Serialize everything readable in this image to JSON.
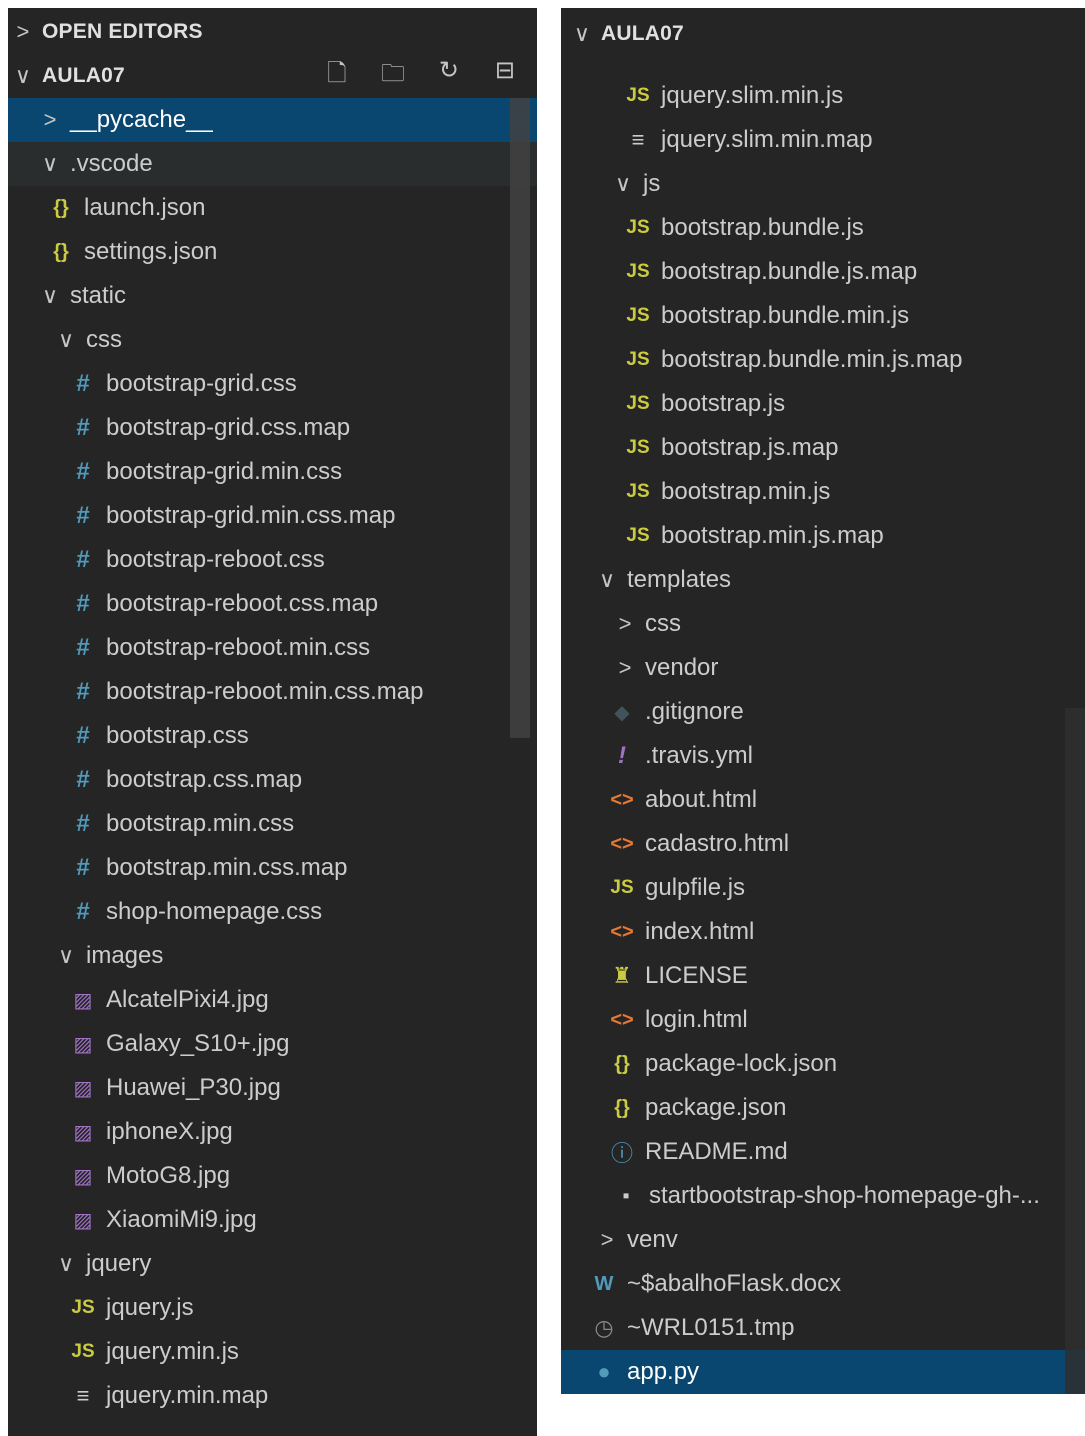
{
  "left_panel": {
    "open_editors_label": "OPEN EDITORS",
    "workspace_label": "AULA07",
    "header_actions": [
      "new-file-icon",
      "new-folder-icon",
      "refresh-icon",
      "collapse-all-icon"
    ],
    "rows": [
      {
        "label": "__pycache__",
        "kind": "folder-closed"
      },
      {
        "label": ".vscode",
        "kind": "folder-open"
      },
      {
        "label": "launch.json",
        "icon": "json"
      },
      {
        "label": "settings.json",
        "icon": "json"
      },
      {
        "label": "static",
        "kind": "folder-open"
      },
      {
        "label": "css",
        "kind": "folder-open"
      },
      {
        "label": "bootstrap-grid.css",
        "icon": "css"
      },
      {
        "label": "bootstrap-grid.css.map",
        "icon": "css"
      },
      {
        "label": "bootstrap-grid.min.css",
        "icon": "css"
      },
      {
        "label": "bootstrap-grid.min.css.map",
        "icon": "css"
      },
      {
        "label": "bootstrap-reboot.css",
        "icon": "css"
      },
      {
        "label": "bootstrap-reboot.css.map",
        "icon": "css"
      },
      {
        "label": "bootstrap-reboot.min.css",
        "icon": "css"
      },
      {
        "label": "bootstrap-reboot.min.css.map",
        "icon": "css"
      },
      {
        "label": "bootstrap.css",
        "icon": "css"
      },
      {
        "label": "bootstrap.css.map",
        "icon": "css"
      },
      {
        "label": "bootstrap.min.css",
        "icon": "css"
      },
      {
        "label": "bootstrap.min.css.map",
        "icon": "css"
      },
      {
        "label": "shop-homepage.css",
        "icon": "css"
      },
      {
        "label": "images",
        "kind": "folder-open"
      },
      {
        "label": "AlcatelPixi4.jpg",
        "icon": "image"
      },
      {
        "label": "Galaxy_S10+.jpg",
        "icon": "image"
      },
      {
        "label": "Huawei_P30.jpg",
        "icon": "image"
      },
      {
        "label": "iphoneX.jpg",
        "icon": "image"
      },
      {
        "label": "MotoG8.jpg",
        "icon": "image"
      },
      {
        "label": "XiaomiMi9.jpg",
        "icon": "image"
      },
      {
        "label": "jquery",
        "kind": "folder-open"
      },
      {
        "label": "jquery.js",
        "icon": "js"
      },
      {
        "label": "jquery.min.js",
        "icon": "js"
      },
      {
        "label": "jquery.min.map",
        "icon": "map"
      }
    ]
  },
  "right_panel": {
    "workspace_label": "AULA07",
    "rows": [
      {
        "label": "jquery.slim.min.js",
        "icon": "js"
      },
      {
        "label": "jquery.slim.min.map",
        "icon": "map"
      },
      {
        "label": "js",
        "kind": "folder-open"
      },
      {
        "label": "bootstrap.bundle.js",
        "icon": "js"
      },
      {
        "label": "bootstrap.bundle.js.map",
        "icon": "js"
      },
      {
        "label": "bootstrap.bundle.min.js",
        "icon": "js"
      },
      {
        "label": "bootstrap.bundle.min.js.map",
        "icon": "js"
      },
      {
        "label": "bootstrap.js",
        "icon": "js"
      },
      {
        "label": "bootstrap.js.map",
        "icon": "js"
      },
      {
        "label": "bootstrap.min.js",
        "icon": "js"
      },
      {
        "label": "bootstrap.min.js.map",
        "icon": "js"
      },
      {
        "label": "templates",
        "kind": "folder-open"
      },
      {
        "label": "css",
        "kind": "folder-closed"
      },
      {
        "label": "vendor",
        "kind": "folder-closed"
      },
      {
        "label": ".gitignore",
        "icon": "git"
      },
      {
        "label": ".travis.yml",
        "icon": "yml"
      },
      {
        "label": "about.html",
        "icon": "html"
      },
      {
        "label": "cadastro.html",
        "icon": "html"
      },
      {
        "label": "gulpfile.js",
        "icon": "js"
      },
      {
        "label": "index.html",
        "icon": "html"
      },
      {
        "label": "LICENSE",
        "icon": "license"
      },
      {
        "label": "login.html",
        "icon": "html"
      },
      {
        "label": "package-lock.json",
        "icon": "json"
      },
      {
        "label": "package.json",
        "icon": "json"
      },
      {
        "label": "README.md",
        "icon": "info"
      },
      {
        "label": "startbootstrap-shop-homepage-gh-...",
        "icon": "zip"
      },
      {
        "label": "venv",
        "kind": "folder-closed"
      },
      {
        "label": "~$abalhoFlask.docx",
        "icon": "word"
      },
      {
        "label": "~WRL0151.tmp",
        "icon": "tmp"
      },
      {
        "label": "app.py",
        "icon": "python"
      }
    ]
  },
  "icon_glyphs": {
    "js": "JS",
    "css": "#",
    "json": "{}",
    "image": "▨",
    "map": "≡",
    "html": "<>",
    "git": "◆",
    "yml": "!",
    "license": "♜",
    "info": "ⓘ",
    "zip": "▪",
    "word": "W",
    "tmp": "◷",
    "python": "●"
  },
  "colors": {
    "sidebar_bg": "#252526",
    "selected_bg": "#094771",
    "hover_bg": "#2a2d2e",
    "text": "#cccccc",
    "js_icon": "#cbcb41",
    "css_icon": "#519aba",
    "html_icon": "#e37933"
  }
}
